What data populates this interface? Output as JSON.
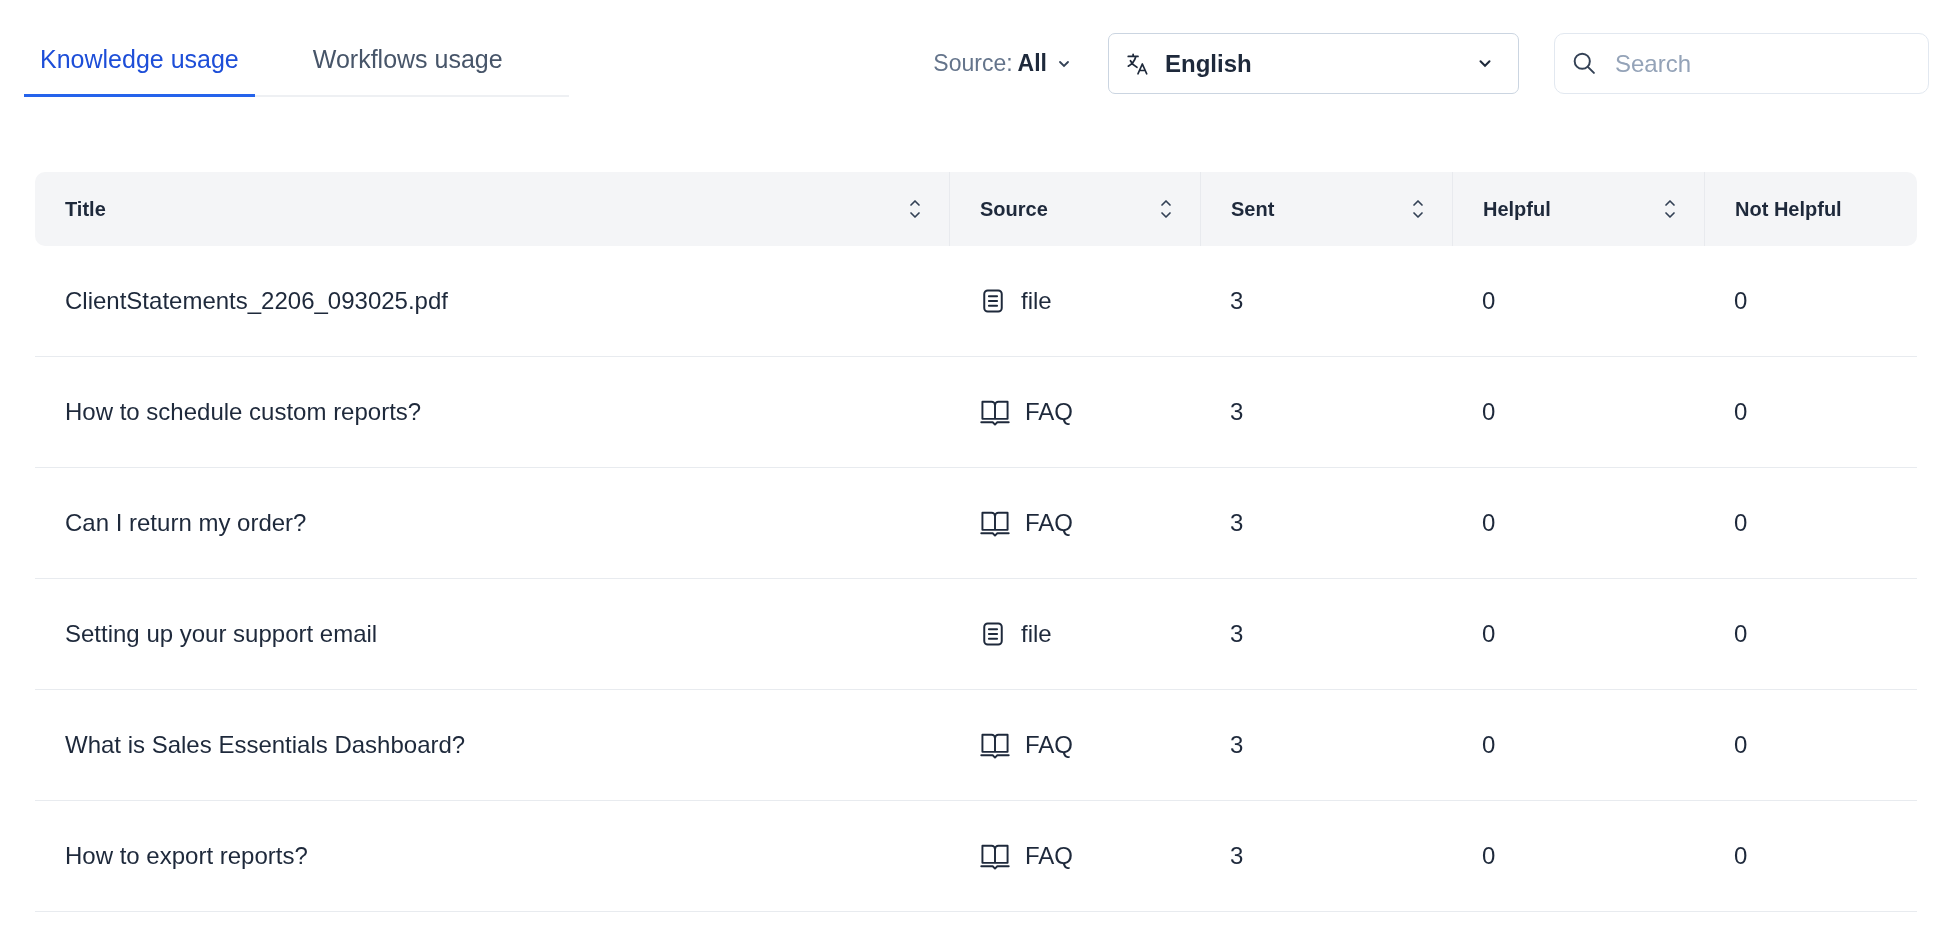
{
  "tabs": [
    {
      "label": "Knowledge usage",
      "selected": true
    },
    {
      "label": "Workflows usage",
      "selected": false
    }
  ],
  "source_filter": {
    "label": "Source:",
    "value": "All"
  },
  "language_select": {
    "value": "English"
  },
  "search": {
    "placeholder": "Search"
  },
  "table": {
    "columns": [
      {
        "label": "Title",
        "sortable": true
      },
      {
        "label": "Source",
        "sortable": true
      },
      {
        "label": "Sent",
        "sortable": true
      },
      {
        "label": "Helpful",
        "sortable": true
      },
      {
        "label": "Not Helpful",
        "sortable": false
      }
    ],
    "rows": [
      {
        "title": "ClientStatements_2206_093025.pdf",
        "source": {
          "kind": "file",
          "label": "file"
        },
        "sent": "3",
        "helpful": "0",
        "not_helpful": "0"
      },
      {
        "title": "How to schedule custom reports?",
        "source": {
          "kind": "faq",
          "label": "FAQ"
        },
        "sent": "3",
        "helpful": "0",
        "not_helpful": "0"
      },
      {
        "title": "Can I return my order?",
        "source": {
          "kind": "faq",
          "label": "FAQ"
        },
        "sent": "3",
        "helpful": "0",
        "not_helpful": "0"
      },
      {
        "title": "Setting up your support email",
        "source": {
          "kind": "file",
          "label": "file"
        },
        "sent": "3",
        "helpful": "0",
        "not_helpful": "0"
      },
      {
        "title": "What is Sales Essentials Dashboard?",
        "source": {
          "kind": "faq",
          "label": "FAQ"
        },
        "sent": "3",
        "helpful": "0",
        "not_helpful": "0"
      },
      {
        "title": "How to export reports?",
        "source": {
          "kind": "faq",
          "label": "FAQ"
        },
        "sent": "3",
        "helpful": "0",
        "not_helpful": "0"
      }
    ]
  }
}
